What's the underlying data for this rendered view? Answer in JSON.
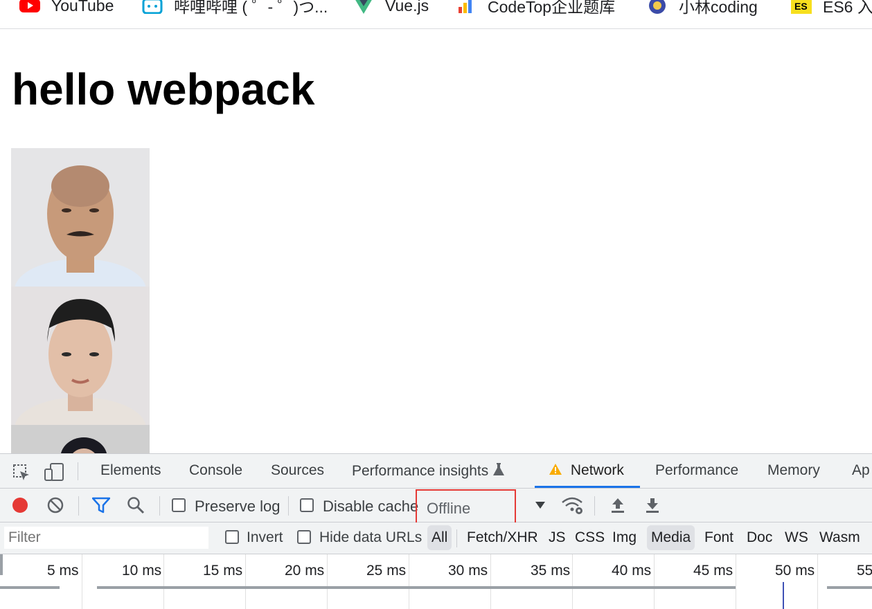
{
  "bookmarks": [
    {
      "label": "YouTube",
      "icon": "youtube-icon"
    },
    {
      "label": "哔哩哔哩 ( ゜- ゜)つ...",
      "icon": "bilibili-icon"
    },
    {
      "label": "Vue.js",
      "icon": "vue-icon"
    },
    {
      "label": "CodeTop企业题库",
      "icon": "codetop-icon"
    },
    {
      "label": "小林coding",
      "icon": "xiaolin-icon"
    },
    {
      "label": "ES6 入",
      "icon": "es-icon"
    }
  ],
  "page": {
    "title": "hello webpack"
  },
  "devtools": {
    "tabs": [
      "Elements",
      "Console",
      "Sources",
      "Performance insights",
      "Network",
      "Performance",
      "Memory",
      "Ap"
    ],
    "active_tab": "Network",
    "toolbar": {
      "preserve_log": "Preserve log",
      "disable_cache": "Disable cache",
      "throttling": "Offline"
    },
    "filter": {
      "placeholder": "Filter",
      "invert": "Invert",
      "hide_data_urls": "Hide data URLs",
      "types": [
        "All",
        "Fetch/XHR",
        "JS",
        "CSS",
        "Img",
        "Media",
        "Font",
        "Doc",
        "WS",
        "Wasm"
      ],
      "selected": [
        "All",
        "Media"
      ]
    },
    "timeline": {
      "ticks": [
        "5 ms",
        "10 ms",
        "15 ms",
        "20 ms",
        "25 ms",
        "30 ms",
        "35 ms",
        "40 ms",
        "45 ms",
        "50 ms",
        "55"
      ]
    }
  },
  "colors": {
    "record": "#e53935",
    "accent": "#1a73e8",
    "warning": "#f9ab00",
    "highlight_box": "#e53935"
  }
}
